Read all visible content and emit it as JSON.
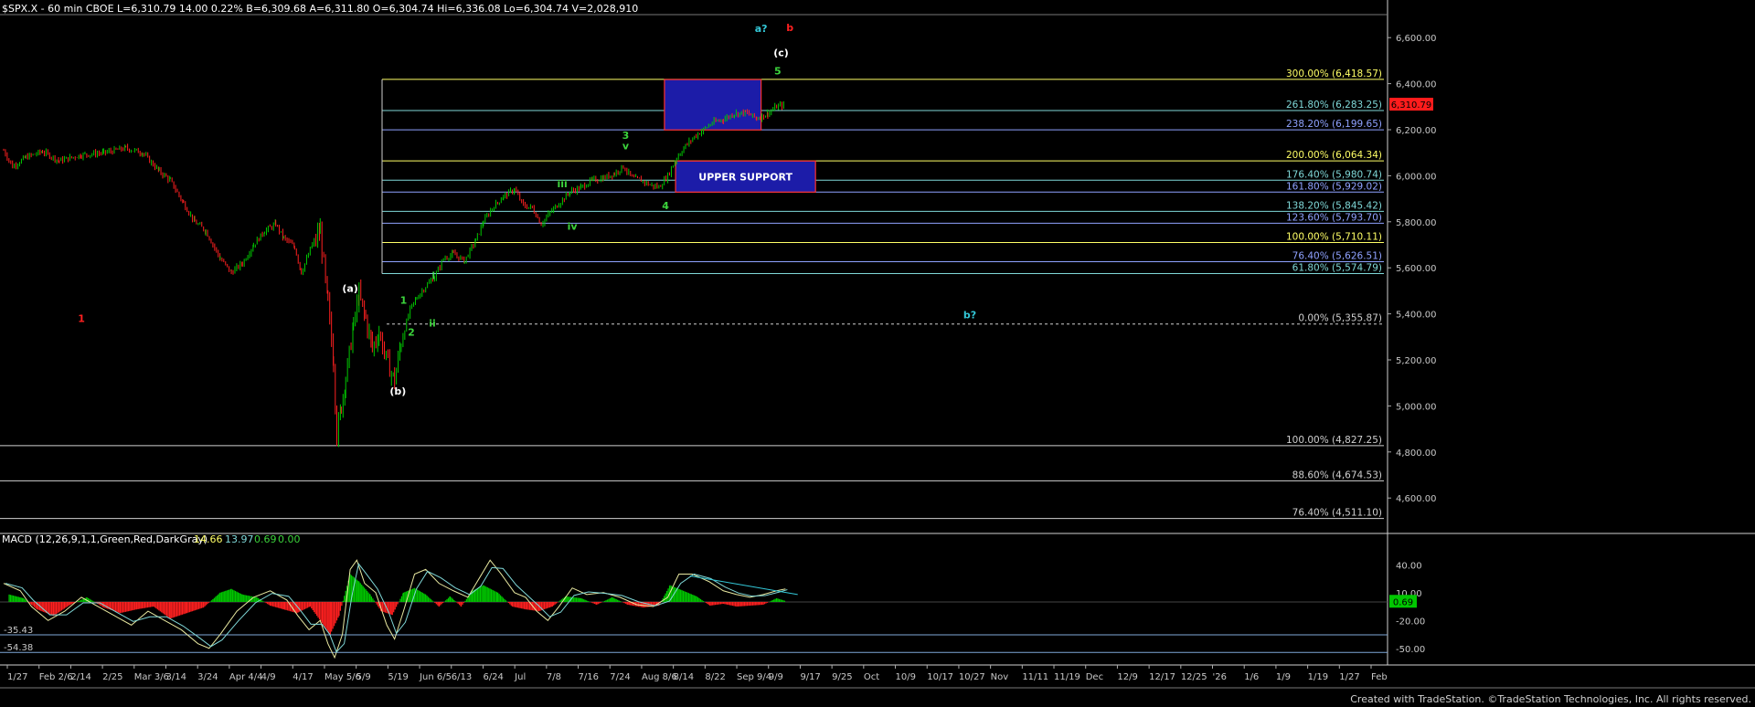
{
  "header": {
    "symbol_line": "$SPX.X - 60 min  CBOE  L=6,310.79  14.00  0.22%  B=6,309.68  A=6,311.80  O=6,304.74  Hi=6,336.08  Lo=6,304.74  V=2,028,910"
  },
  "macd_header": {
    "label": "MACD (12,26,9,1,1,Green,Red,DarkGray)",
    "v1": "14.66",
    "v2": "13.97",
    "v3": "0.69",
    "v4": "0.00"
  },
  "credit": "Created with TradeStation. ©TradeStation Technologies, Inc. All rights reserved.",
  "colors": {
    "background": "#000000",
    "bull_bar": "#00c800",
    "bear_bar": "#ff2020",
    "fib_yellow": "#ffff66",
    "fib_blue": "#8fa2ff",
    "fib_teal": "#7fd8d8",
    "fib_white": "#cfcfcf",
    "box_fill": "#1c1ca8",
    "box_border": "#ff3030",
    "wave_green": "#3cd43c",
    "wave_cyan": "#33c8d8",
    "wave_red": "#ff2020",
    "price_badge": "#ff1c1c"
  },
  "chart_data": {
    "type": "candlestick",
    "symbol": "$SPX.X",
    "interval": "60 min",
    "ylim": [
      4450,
      6700
    ],
    "y_ticks": [
      "4,600.00",
      "4,800.00",
      "5,000.00",
      "5,200.00",
      "5,400.00",
      "5,600.00",
      "5,800.00",
      "6,000.00",
      "6,200.00",
      "6,400.00",
      "6,600.00"
    ],
    "last_price_badge": "6,310.79",
    "x_labels": [
      "1/27",
      "Feb 2/6",
      "2/14",
      "2/25",
      "Mar 3/6",
      "3/14",
      "3/24",
      "Apr 4/4",
      "4/9",
      "4/17",
      "May 5/6",
      "5/9",
      "5/19",
      "Jun 6/5",
      "6/13",
      "6/24",
      "Jul",
      "7/8",
      "7/16",
      "7/24",
      "Aug 8/6",
      "8/14",
      "8/22",
      "Sep 9/4",
      "9/9",
      "9/17",
      "9/25",
      "Oct",
      "10/9",
      "10/17",
      "10/27",
      "Nov",
      "11/11",
      "11/19",
      "Dec",
      "12/9",
      "12/17",
      "12/25",
      "'26",
      "1/6",
      "1/9",
      "1/19",
      "1/27",
      "Feb"
    ],
    "price_path": [
      [
        0,
        6110
      ],
      [
        8,
        6040
      ],
      [
        20,
        6080
      ],
      [
        35,
        6105
      ],
      [
        50,
        6065
      ],
      [
        70,
        6090
      ],
      [
        90,
        6100
      ],
      [
        110,
        6120
      ],
      [
        125,
        6100
      ],
      [
        140,
        6020
      ],
      [
        150,
        5980
      ],
      [
        162,
        5880
      ],
      [
        172,
        5800
      ],
      [
        182,
        5760
      ],
      [
        195,
        5640
      ],
      [
        205,
        5580
      ],
      [
        215,
        5620
      ],
      [
        225,
        5700
      ],
      [
        235,
        5760
      ],
      [
        245,
        5790
      ],
      [
        252,
        5730
      ],
      [
        262,
        5690
      ],
      [
        268,
        5580
      ],
      [
        278,
        5700
      ],
      [
        285,
        5760
      ],
      [
        292,
        5440
      ],
      [
        297,
        5200
      ],
      [
        300,
        4870
      ],
      [
        304,
        5000
      ],
      [
        308,
        5120
      ],
      [
        315,
        5350
      ],
      [
        320,
        5480
      ],
      [
        326,
        5380
      ],
      [
        332,
        5250
      ],
      [
        338,
        5320
      ],
      [
        346,
        5180
      ],
      [
        352,
        5110
      ],
      [
        358,
        5280
      ],
      [
        366,
        5420
      ],
      [
        372,
        5470
      ],
      [
        380,
        5520
      ],
      [
        388,
        5560
      ],
      [
        396,
        5640
      ],
      [
        405,
        5660
      ],
      [
        415,
        5630
      ],
      [
        425,
        5720
      ],
      [
        432,
        5800
      ],
      [
        440,
        5860
      ],
      [
        450,
        5910
      ],
      [
        460,
        5940
      ],
      [
        468,
        5870
      ],
      [
        476,
        5860
      ],
      [
        484,
        5790
      ],
      [
        492,
        5840
      ],
      [
        500,
        5880
      ],
      [
        510,
        5930
      ],
      [
        520,
        5950
      ],
      [
        530,
        5980
      ],
      [
        540,
        5990
      ],
      [
        550,
        6010
      ],
      [
        558,
        6040
      ],
      [
        566,
        5990
      ],
      [
        574,
        5980
      ],
      [
        582,
        5960
      ],
      [
        590,
        5950
      ],
      [
        598,
        6000
      ],
      [
        606,
        6080
      ],
      [
        614,
        6130
      ],
      [
        622,
        6170
      ],
      [
        630,
        6200
      ],
      [
        638,
        6230
      ],
      [
        648,
        6245
      ],
      [
        658,
        6270
      ],
      [
        668,
        6275
      ],
      [
        678,
        6250
      ],
      [
        688,
        6270
      ],
      [
        696,
        6300
      ],
      [
        704,
        6310
      ]
    ],
    "fib_levels": [
      {
        "label": "300.00% (6,418.57)",
        "price": 6418.57,
        "color": "yellow"
      },
      {
        "label": "261.80% (6,283.25)",
        "price": 6283.25,
        "color": "teal"
      },
      {
        "label": "238.20% (6,199.65)",
        "price": 6199.65,
        "color": "blue"
      },
      {
        "label": "200.00% (6,064.34)",
        "price": 6064.34,
        "color": "yellow"
      },
      {
        "label": "176.40% (5,980.74)",
        "price": 5980.74,
        "color": "teal"
      },
      {
        "label": "161.80% (5,929.02)",
        "price": 5929.02,
        "color": "blue"
      },
      {
        "label": "138.20% (5,845.42)",
        "price": 5845.42,
        "color": "teal"
      },
      {
        "label": "123.60% (5,793.70)",
        "price": 5793.7,
        "color": "blue"
      },
      {
        "label": "100.00% (5,710.11)",
        "price": 5710.11,
        "color": "yellow"
      },
      {
        "label": "76.40% (5,626.51)",
        "price": 5626.51,
        "color": "blue"
      },
      {
        "label": "61.80% (5,574.79)",
        "price": 5574.79,
        "color": "teal"
      },
      {
        "label": "0.00% (5,355.87)",
        "price": 5355.87,
        "color": "white"
      },
      {
        "label": "100.00% (4,827.25)",
        "price": 4827.25,
        "color": "white"
      },
      {
        "label": "88.60% (4,674.53)",
        "price": 4674.53,
        "color": "white"
      },
      {
        "label": "76.40% (4,511.10)",
        "price": 4511.1,
        "color": "white"
      }
    ],
    "boxes": [
      {
        "label": "",
        "x0": 595,
        "x1": 682,
        "p_top": 6418,
        "p_bot": 6199,
        "color": "box"
      },
      {
        "label": "UPPER SUPPORT",
        "x0": 605,
        "x1": 731,
        "p_top": 6064,
        "p_bot": 5929,
        "color": "box"
      }
    ],
    "wave_labels": [
      {
        "text": "a?",
        "x": 682,
        "p": 6625,
        "color": "cyan"
      },
      {
        "text": "b",
        "x": 708,
        "p": 6628,
        "color": "red",
        "big": true
      },
      {
        "text": "(c)",
        "x": 700,
        "p": 6520,
        "color": "white"
      },
      {
        "text": "5",
        "x": 697,
        "p": 6440,
        "color": "green"
      },
      {
        "text": "3",
        "x": 560,
        "p": 6160,
        "color": "green"
      },
      {
        "text": "v",
        "x": 560,
        "p": 6115,
        "color": "green"
      },
      {
        "text": "iii",
        "x": 503,
        "p": 5950,
        "color": "green"
      },
      {
        "text": "4",
        "x": 596,
        "p": 5855,
        "color": "green"
      },
      {
        "text": "iv",
        "x": 512,
        "p": 5765,
        "color": "green"
      },
      {
        "text": "(a)",
        "x": 312,
        "p": 5495,
        "color": "white"
      },
      {
        "text": "1",
        "x": 360,
        "p": 5445,
        "color": "green"
      },
      {
        "text": "i",
        "x": 387,
        "p": 5552,
        "color": "green"
      },
      {
        "text": "ii",
        "x": 386,
        "p": 5345,
        "color": "green"
      },
      {
        "text": "2",
        "x": 367,
        "p": 5305,
        "color": "green"
      },
      {
        "text": "1",
        "x": 70,
        "p": 5365,
        "color": "red"
      },
      {
        "text": "b?",
        "x": 870,
        "p": 5380,
        "color": "cyan"
      },
      {
        "text": "(b)",
        "x": 355,
        "p": 5050,
        "color": "white"
      }
    ],
    "macd": {
      "ylim": [
        -65,
        60
      ],
      "ticks": [
        "40.00",
        "10.00",
        "-20.00",
        "-50.00"
      ],
      "current": "0.69",
      "horizontal_levels": [
        "-35.43",
        "-54.38"
      ],
      "macd_path": [
        [
          0,
          20
        ],
        [
          15,
          12
        ],
        [
          25,
          -5
        ],
        [
          40,
          -20
        ],
        [
          55,
          -10
        ],
        [
          70,
          5
        ],
        [
          85,
          -5
        ],
        [
          100,
          -15
        ],
        [
          115,
          -25
        ],
        [
          130,
          -10
        ],
        [
          145,
          -20
        ],
        [
          160,
          -30
        ],
        [
          175,
          -45
        ],
        [
          185,
          -50
        ],
        [
          195,
          -35
        ],
        [
          210,
          -10
        ],
        [
          225,
          5
        ],
        [
          240,
          12
        ],
        [
          255,
          2
        ],
        [
          265,
          -15
        ],
        [
          275,
          -30
        ],
        [
          285,
          -20
        ],
        [
          292,
          -45
        ],
        [
          298,
          -60
        ],
        [
          305,
          -35
        ],
        [
          312,
          35
        ],
        [
          318,
          45
        ],
        [
          325,
          20
        ],
        [
          335,
          10
        ],
        [
          345,
          -25
        ],
        [
          352,
          -40
        ],
        [
          360,
          -10
        ],
        [
          370,
          30
        ],
        [
          380,
          35
        ],
        [
          392,
          20
        ],
        [
          405,
          12
        ],
        [
          418,
          5
        ],
        [
          428,
          25
        ],
        [
          438,
          45
        ],
        [
          448,
          30
        ],
        [
          460,
          10
        ],
        [
          470,
          5
        ],
        [
          480,
          -10
        ],
        [
          490,
          -20
        ],
        [
          500,
          -5
        ],
        [
          512,
          15
        ],
        [
          525,
          8
        ],
        [
          540,
          10
        ],
        [
          555,
          5
        ],
        [
          570,
          -3
        ],
        [
          585,
          -5
        ],
        [
          598,
          5
        ],
        [
          608,
          30
        ],
        [
          620,
          30
        ],
        [
          635,
          22
        ],
        [
          648,
          12
        ],
        [
          660,
          8
        ],
        [
          672,
          5
        ],
        [
          684,
          8
        ],
        [
          696,
          12
        ],
        [
          704,
          14
        ]
      ],
      "hist": [
        [
          5,
          8
        ],
        [
          18,
          4
        ],
        [
          30,
          -8
        ],
        [
          45,
          -15
        ],
        [
          60,
          -3
        ],
        [
          75,
          5
        ],
        [
          90,
          -6
        ],
        [
          105,
          -12
        ],
        [
          120,
          -8
        ],
        [
          135,
          -5
        ],
        [
          150,
          -18
        ],
        [
          165,
          -12
        ],
        [
          180,
          -6
        ],
        [
          195,
          10
        ],
        [
          205,
          14
        ],
        [
          215,
          8
        ],
        [
          228,
          5
        ],
        [
          240,
          -4
        ],
        [
          252,
          -8
        ],
        [
          264,
          -12
        ],
        [
          276,
          -5
        ],
        [
          288,
          -25
        ],
        [
          294,
          -35
        ],
        [
          302,
          -15
        ],
        [
          312,
          30
        ],
        [
          320,
          22
        ],
        [
          330,
          8
        ],
        [
          340,
          -10
        ],
        [
          350,
          -14
        ],
        [
          360,
          10
        ],
        [
          370,
          15
        ],
        [
          380,
          8
        ],
        [
          392,
          -5
        ],
        [
          402,
          6
        ],
        [
          412,
          -5
        ],
        [
          422,
          12
        ],
        [
          432,
          18
        ],
        [
          445,
          10
        ],
        [
          458,
          -5
        ],
        [
          470,
          -8
        ],
        [
          482,
          -10
        ],
        [
          494,
          -5
        ],
        [
          506,
          6
        ],
        [
          520,
          4
        ],
        [
          534,
          -3
        ],
        [
          548,
          5
        ],
        [
          562,
          -3
        ],
        [
          576,
          -6
        ],
        [
          590,
          -4
        ],
        [
          600,
          18
        ],
        [
          612,
          12
        ],
        [
          624,
          6
        ],
        [
          636,
          -4
        ],
        [
          648,
          -2
        ],
        [
          660,
          -5
        ],
        [
          672,
          -4
        ],
        [
          684,
          -3
        ],
        [
          696,
          4
        ],
        [
          704,
          1
        ]
      ],
      "divergence_line": [
        [
          618,
          28
        ],
        [
          715,
          8
        ]
      ]
    }
  }
}
